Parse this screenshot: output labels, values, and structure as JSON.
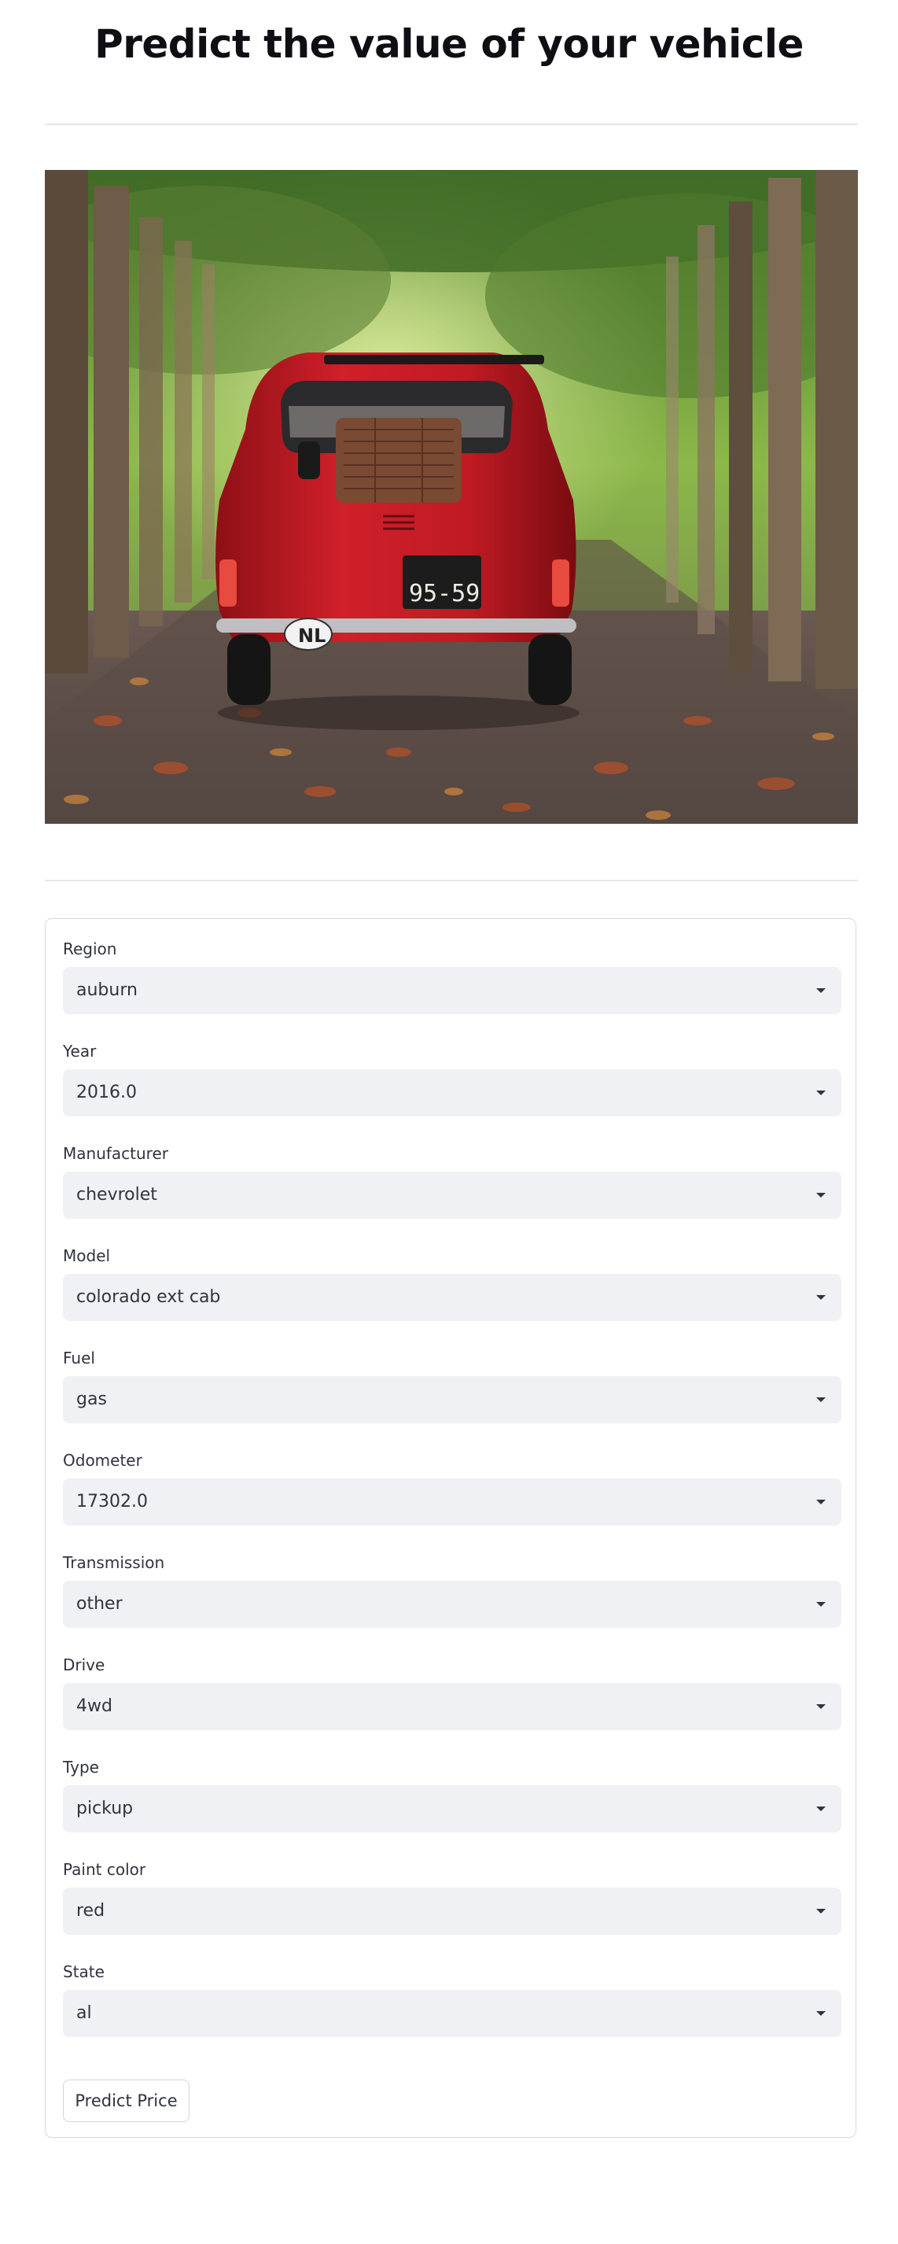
{
  "title": "Predict the value of your vehicle",
  "hero_image": {
    "description_icon": "red-vintage-car-image",
    "license_plate": "95-59",
    "oval_badge": "NL"
  },
  "form": {
    "fields": [
      {
        "label": "Region",
        "value": "auburn"
      },
      {
        "label": "Year",
        "value": "2016.0"
      },
      {
        "label": "Manufacturer",
        "value": "chevrolet"
      },
      {
        "label": "Model",
        "value": "colorado ext cab"
      },
      {
        "label": "Fuel",
        "value": "gas"
      },
      {
        "label": "Odometer",
        "value": "17302.0"
      },
      {
        "label": "Transmission",
        "value": "other"
      },
      {
        "label": "Drive",
        "value": "4wd"
      },
      {
        "label": "Type",
        "value": "pickup"
      },
      {
        "label": "Paint color",
        "value": "red"
      },
      {
        "label": "State",
        "value": "al"
      }
    ],
    "submit_label": "Predict Price"
  },
  "colors": {
    "select_bg": "#f0f1f4",
    "text": "#31333f",
    "divider": "#e6e6ea",
    "car_red": "#c41a22"
  }
}
